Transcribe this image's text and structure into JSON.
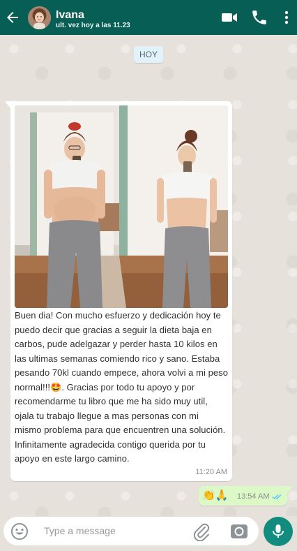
{
  "header": {
    "contact_name": "Ivana",
    "last_seen": "ult. vez hoy a las 11.23",
    "bg_color": "#075e54",
    "icons": [
      "back-arrow-icon",
      "video-call-icon",
      "phone-icon",
      "more-vertical-icon"
    ]
  },
  "date_chip": "HOY",
  "messages": [
    {
      "direction": "incoming",
      "has_image": true,
      "text": "Buen dia! Con mucho esfuerzo y dedicación hoy te puedo decir que gracias a seguir la dieta baja en carbos, pude adelgazar y perder hasta 10 kilos en las ultimas semanas comiendo rico y sano. Estaba pesando 70kl cuando empece, ahora volvi a mi peso normal!!!🤩. Gracias por todo tu apoyo y por recomendarme tu libro que me ha sido muy util, ojala tu trabajo llegue a mas personas con mi mismo problema para que encuentren una solución. Infinitamente agradecida contigo querida por tu apoyo en este largo camino.",
      "time": "11:20 AM"
    },
    {
      "direction": "outgoing",
      "text": "👏🙏",
      "time": "13:54 AM",
      "status": "read"
    }
  ],
  "composer": {
    "placeholder": "Type a message",
    "value": "",
    "icons": [
      "emoji-icon",
      "attach-icon",
      "camera-icon",
      "mic-icon"
    ],
    "accent": "#128c7e"
  },
  "colors": {
    "outgoing_bubble": "#dcf8c6",
    "incoming_bubble": "#ffffff",
    "read_ticks": "#4fc3f7"
  }
}
